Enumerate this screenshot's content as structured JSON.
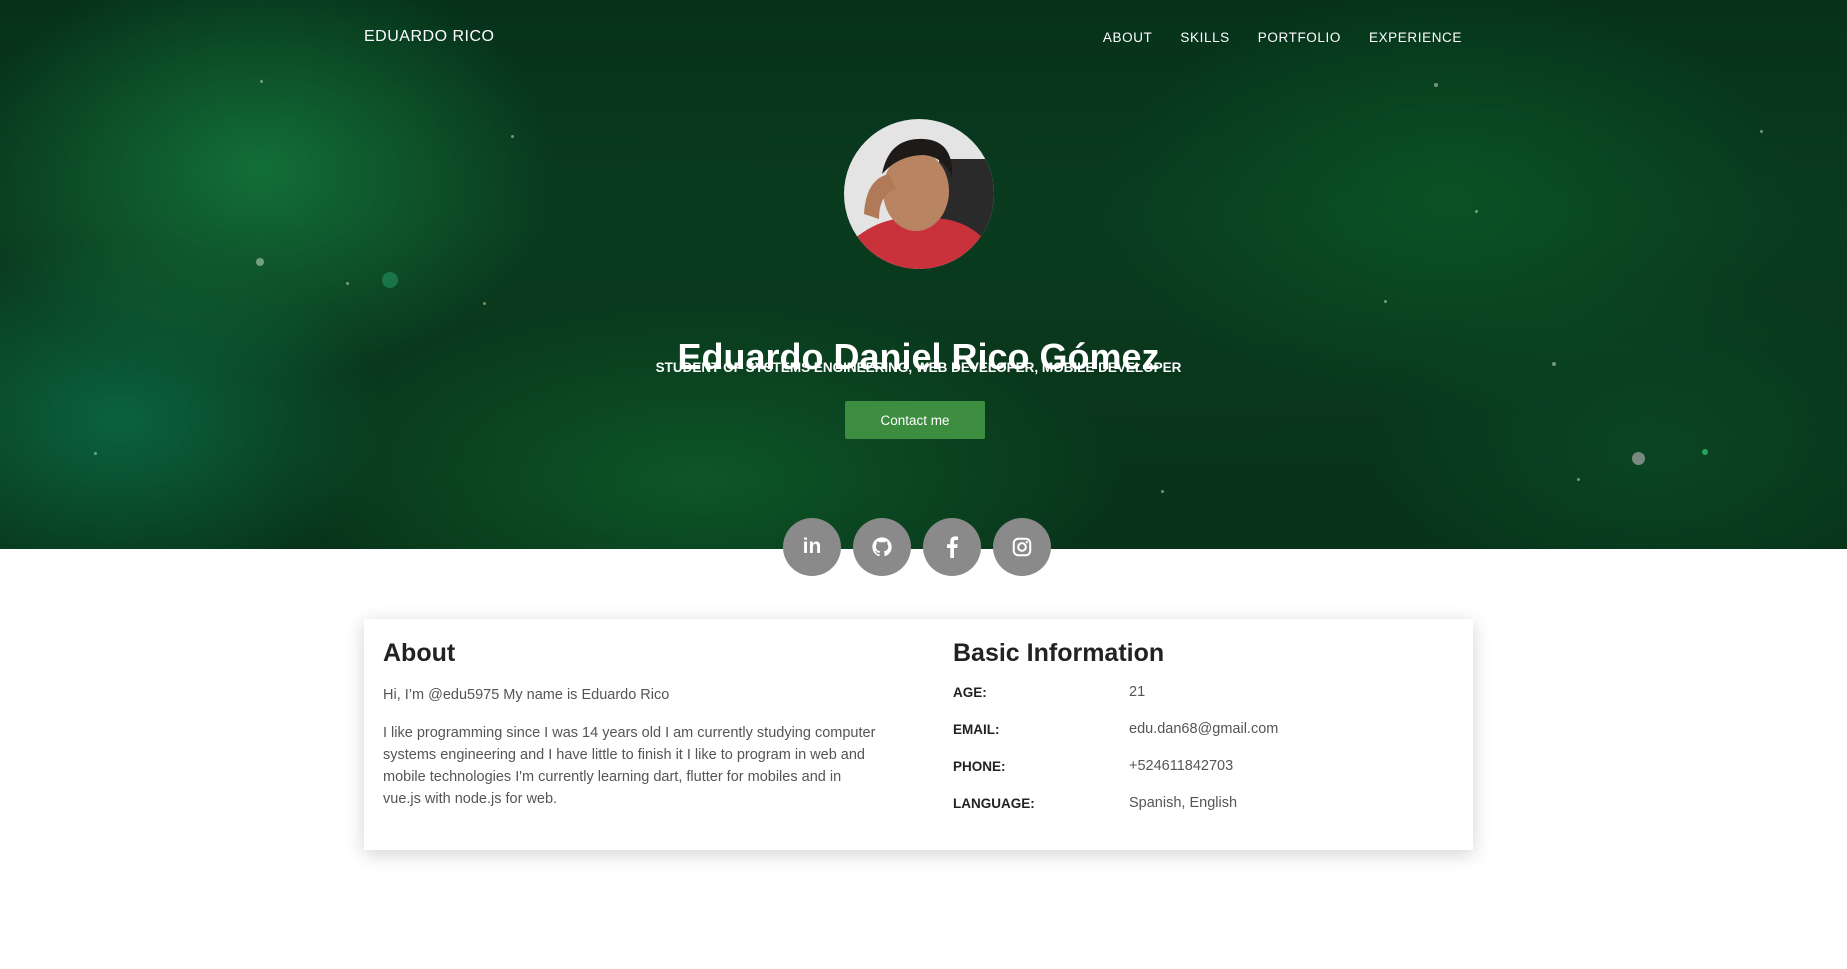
{
  "nav": {
    "brand": "EDUARDO RICO",
    "items": [
      "ABOUT",
      "SKILLS",
      "PORTFOLIO",
      "EXPERIENCE"
    ]
  },
  "hero": {
    "name": "Eduardo Daniel Rico Gómez",
    "subtitle": "STUDENT OF SYSTEMS ENGINEERING, WEB DEVELOPER, MOBILE DEVELOPER",
    "contact_label": "Contact me",
    "button_color": "#3c8d3f"
  },
  "socials": [
    {
      "icon": "linkedin-icon",
      "glyph": "in"
    },
    {
      "icon": "github-icon"
    },
    {
      "icon": "facebook-icon"
    },
    {
      "icon": "instagram-icon"
    }
  ],
  "about": {
    "title": "About",
    "greeting": "Hi, I’m @edu5975 My name is Eduardo Rico",
    "body": "I like programming since I was 14 years old I am currently studying computer systems engineering and I have little to finish it I like to program in web and mobile technologies I'm currently learning dart, flutter for mobiles and in vue.js with node.js for web."
  },
  "info": {
    "title": "Basic Information",
    "rows": [
      {
        "label": "AGE:",
        "value": "21"
      },
      {
        "label": "EMAIL:",
        "value": "edu.dan68@gmail.com"
      },
      {
        "label": "PHONE:",
        "value": "+524611842703"
      },
      {
        "label": "LANGUAGE:",
        "value": "Spanish, English"
      }
    ]
  }
}
